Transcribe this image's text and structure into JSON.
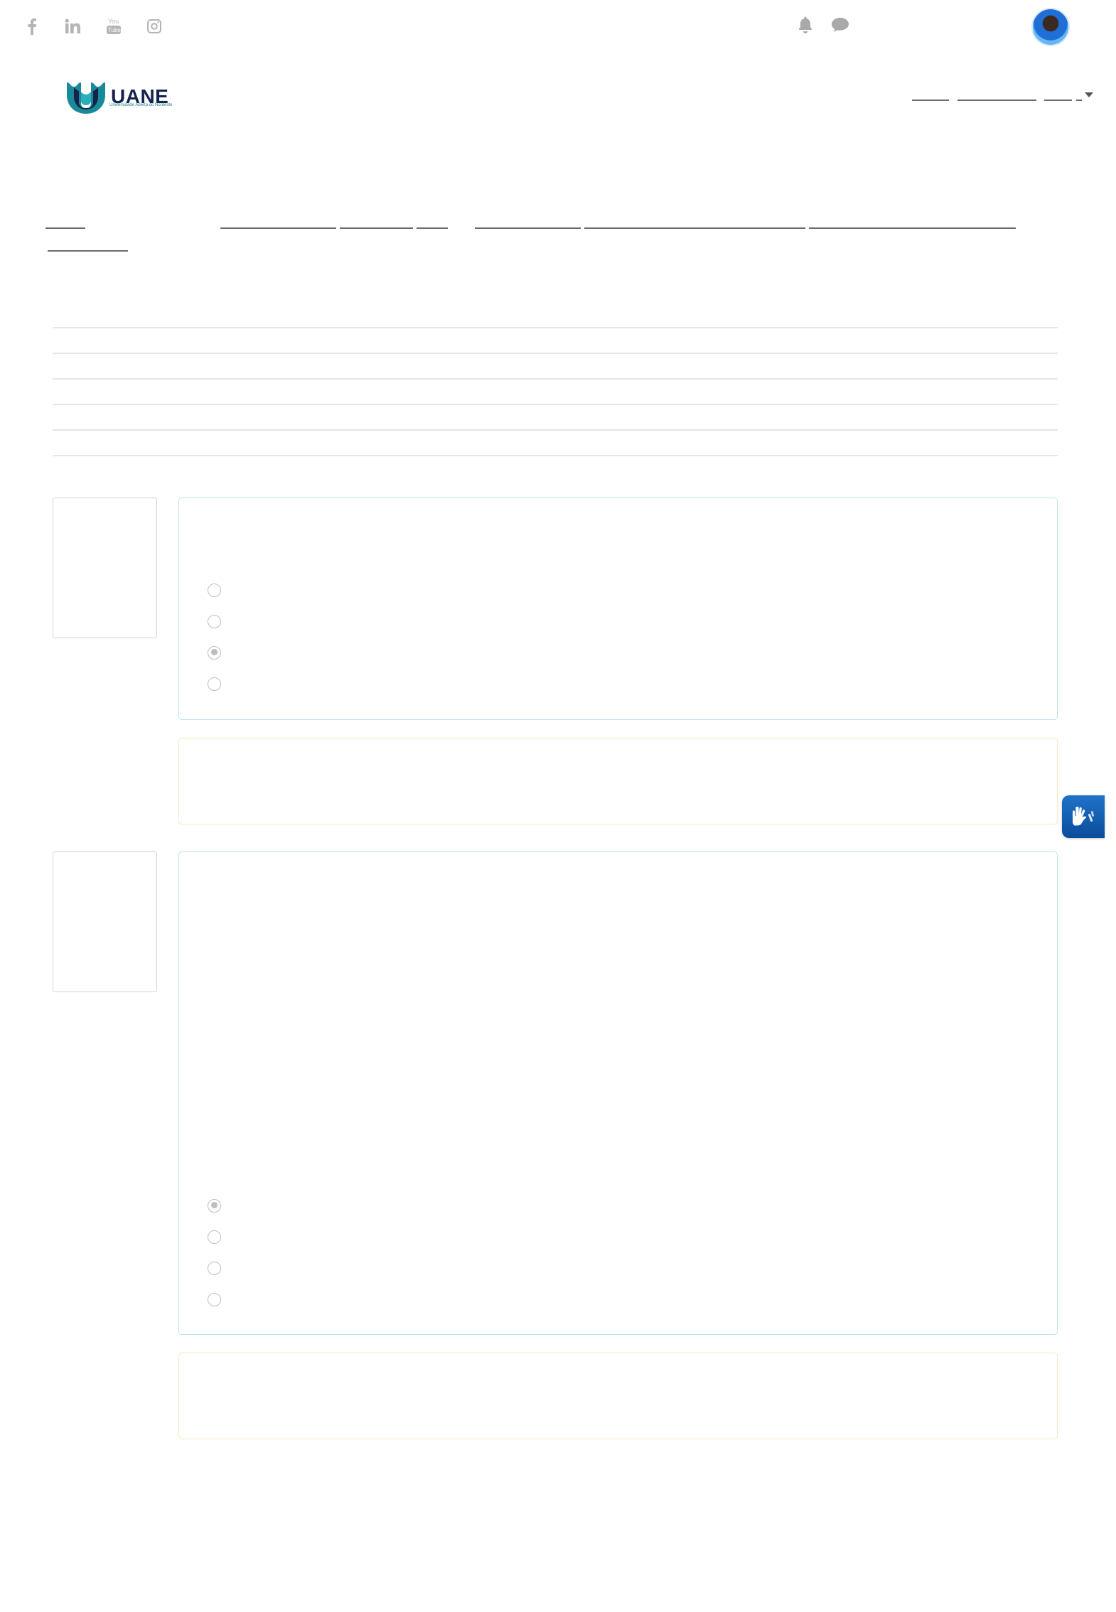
{
  "social": [
    {
      "name": "facebook",
      "icon": "facebook-icon"
    },
    {
      "name": "linkedin",
      "icon": "linkedin-icon"
    },
    {
      "name": "youtube",
      "icon": "youtube-icon"
    },
    {
      "name": "instagram",
      "icon": "instagram-icon"
    }
  ],
  "header": {
    "logo_text": "UANE",
    "logo_subtitle": "Universidade Aberta do Nordeste",
    "user_avatar": "user-avatar",
    "icons": [
      "bell-icon",
      "chat-bubble-icon"
    ]
  },
  "questions": [
    {
      "answers": [
        {
          "selected": false,
          "label": ""
        },
        {
          "selected": false,
          "label": ""
        },
        {
          "selected": true,
          "label": ""
        },
        {
          "selected": false,
          "label": ""
        }
      ]
    },
    {
      "answers": [
        {
          "selected": true,
          "label": ""
        },
        {
          "selected": false,
          "label": ""
        },
        {
          "selected": false,
          "label": ""
        },
        {
          "selected": false,
          "label": ""
        }
      ]
    }
  ],
  "accessibility_widget": {
    "icon": "sign-language-hands-icon"
  },
  "colors": {
    "question_border": "#b9e3ee",
    "feedback_border": "#fbe6bf",
    "logo_text": "#13234d",
    "logo_mark": "#1a8a99",
    "widget": "#1f72c9"
  }
}
